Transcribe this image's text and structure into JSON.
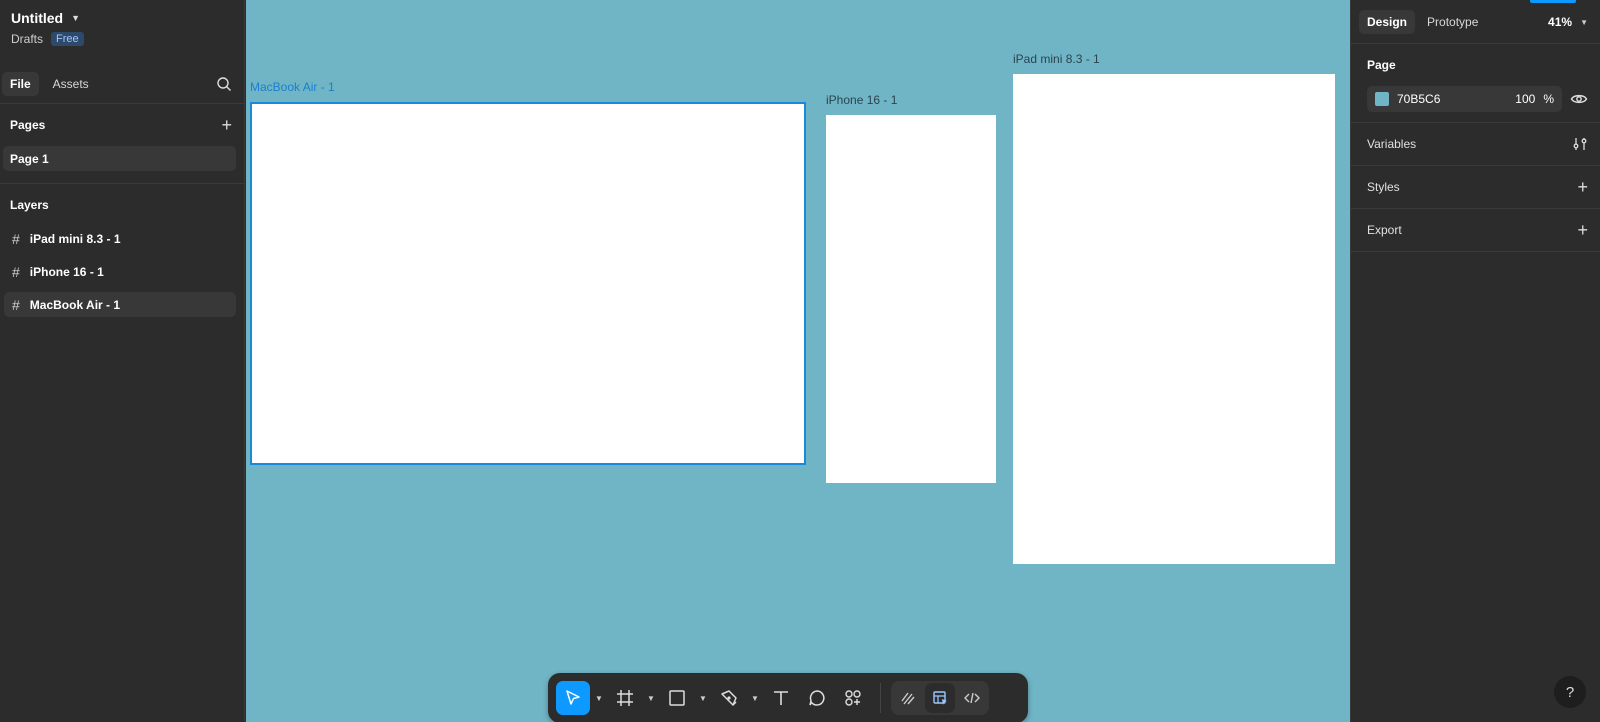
{
  "file": {
    "title": "Untitled",
    "location": "Drafts",
    "plan_badge": "Free"
  },
  "left_tabs": {
    "file": "File",
    "assets": "Assets"
  },
  "pages": {
    "heading": "Pages",
    "items": [
      "Page 1"
    ]
  },
  "layers": {
    "heading": "Layers",
    "items": [
      "iPad mini 8.3 - 1",
      "iPhone 16 - 1",
      "MacBook Air - 1"
    ],
    "selected": "MacBook Air - 1"
  },
  "canvas": {
    "background": "#70B5C6",
    "frames": [
      {
        "label": "MacBook Air - 1",
        "selected": true
      },
      {
        "label": "iPhone 16 - 1",
        "selected": false
      },
      {
        "label": "iPad mini 8.3 - 1",
        "selected": false
      }
    ]
  },
  "right_tabs": {
    "design": "Design",
    "prototype": "Prototype",
    "zoom": "41%"
  },
  "page_panel": {
    "heading": "Page",
    "color_hex": "70B5C6",
    "opacity": "100",
    "opacity_unit": "%"
  },
  "sections": {
    "variables": "Variables",
    "styles": "Styles",
    "export": "Export"
  },
  "help": "?",
  "toolbar": [
    "move-tool",
    "frame-tool",
    "shape-tool",
    "pen-tool",
    "text-tool",
    "comment-tool",
    "actions-tool",
    "draw-mode",
    "design-mode",
    "dev-mode"
  ]
}
